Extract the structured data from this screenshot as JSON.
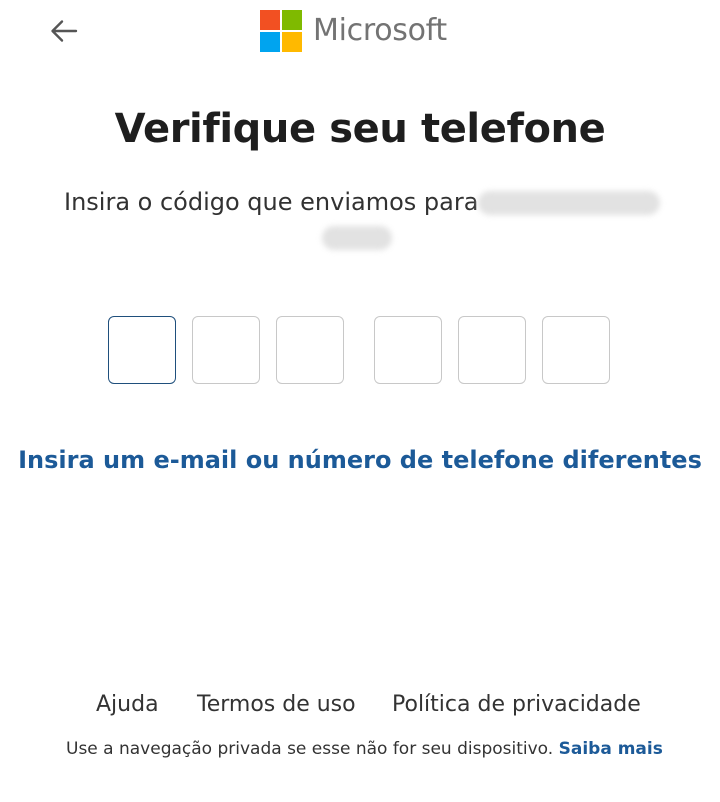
{
  "header": {
    "back_icon": "arrow-left-icon",
    "brand_name": "Microsoft",
    "logo_colors": [
      "#f25022",
      "#7fba00",
      "#00a4ef",
      "#ffb900"
    ]
  },
  "main": {
    "title": "Verifique seu telefone",
    "subtitle": "Insira o código que enviamos para",
    "code_boxes": [
      "",
      "",
      "",
      "",
      "",
      ""
    ],
    "alt_link": "Insira um e-mail ou número de telefone diferentes"
  },
  "footer": {
    "help": "Ajuda",
    "terms": "Termos de uso",
    "privacy": "Política de privacidade",
    "note": "Use a navegação privada se esse não for seu dispositivo.",
    "learn_more": "Saiba mais"
  },
  "colors": {
    "link": "#1c5a98",
    "active_border": "#1f4f7c"
  }
}
